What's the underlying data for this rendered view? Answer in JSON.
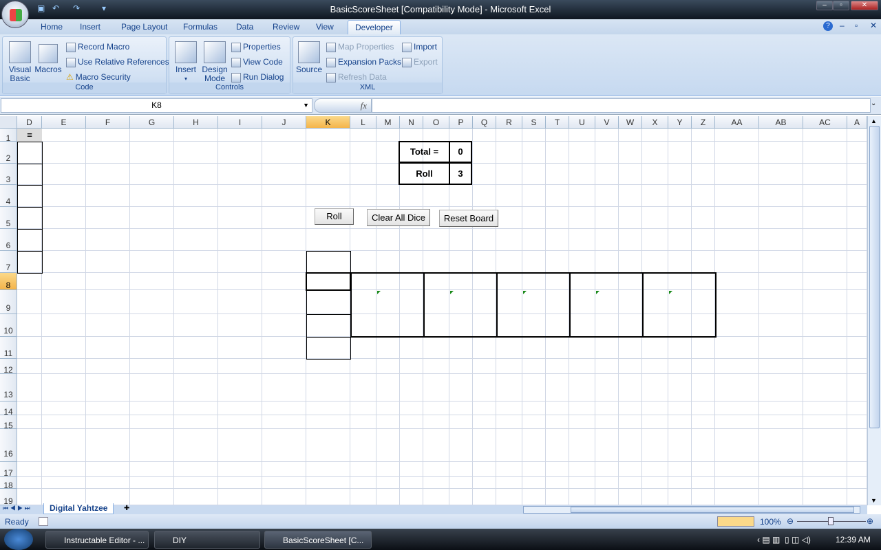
{
  "window": {
    "title": "BasicScoreSheet  [Compatibility Mode] - Microsoft Excel"
  },
  "ribbon": {
    "tabs": [
      "Home",
      "Insert",
      "Page Layout",
      "Formulas",
      "Data",
      "Review",
      "View",
      "Developer"
    ],
    "active_tab": "Developer",
    "groups": {
      "code": {
        "label": "Code",
        "visual_basic": "Visual\nBasic",
        "macros": "Macros",
        "record_macro": "Record Macro",
        "use_relative": "Use Relative References",
        "macro_security": "Macro Security"
      },
      "controls": {
        "label": "Controls",
        "insert": "Insert",
        "design_mode": "Design\nMode",
        "properties": "Properties",
        "view_code": "View Code",
        "run_dialog": "Run Dialog"
      },
      "xml": {
        "label": "XML",
        "source": "Source",
        "map_properties": "Map Properties",
        "expansion_packs": "Expansion Packs",
        "refresh_data": "Refresh Data",
        "import": "Import",
        "export": "Export"
      }
    }
  },
  "formula_bar": {
    "name_box": "K8",
    "fx": "fx",
    "formula": ""
  },
  "columns": [
    "D",
    "E",
    "F",
    "G",
    "H",
    "I",
    "J",
    "K",
    "L",
    "M",
    "N",
    "O",
    "P",
    "Q",
    "R",
    "S",
    "T",
    "U",
    "V",
    "W",
    "X",
    "Y",
    "Z",
    "AA",
    "AB",
    "AC",
    "A"
  ],
  "rows": [
    "1",
    "2",
    "3",
    "4",
    "5",
    "6",
    "7",
    "8",
    "9",
    "10",
    "11",
    "12",
    "13",
    "14",
    "15",
    "16",
    "17",
    "18",
    "19"
  ],
  "selected_cell": "K8",
  "cells": {
    "d1": "=",
    "total_label": "Total =",
    "total_value": "0",
    "roll_label": "Roll",
    "roll_value": "3"
  },
  "buttons": {
    "roll": "Roll",
    "clear": "Clear All Dice",
    "reset": "Reset Board"
  },
  "sheet_tabs": [
    "Digital Yahtzee"
  ],
  "status": {
    "text": "Ready",
    "zoom": "100%"
  },
  "taskbar": {
    "items": [
      "Instructable Editor - ...",
      "DIY",
      "BasicScoreSheet  [C..."
    ],
    "time": "12:39 AM"
  }
}
